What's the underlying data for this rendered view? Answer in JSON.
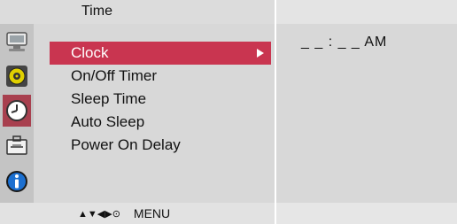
{
  "header": {
    "title": "Time"
  },
  "icons": [
    {
      "name": "picture-icon"
    },
    {
      "name": "sound-icon"
    },
    {
      "name": "clock-icon"
    },
    {
      "name": "option-icon"
    },
    {
      "name": "information-icon"
    }
  ],
  "active_icon_index": 2,
  "menu": {
    "items": [
      {
        "label": "Clock"
      },
      {
        "label": "On/Off Timer"
      },
      {
        "label": "Sleep Time"
      },
      {
        "label": "Auto Sleep"
      },
      {
        "label": "Power On Delay"
      }
    ],
    "selected_index": 0
  },
  "value": {
    "time": "_ _ : _ _  AM"
  },
  "footer": {
    "nav_glyphs": "▲▼◀▶⊙",
    "menu_label": "MENU"
  },
  "colors": {
    "selected_bg": "#c93550",
    "active_icon_bg": "#a8404f",
    "panel_bg": "#d8d8d8"
  }
}
